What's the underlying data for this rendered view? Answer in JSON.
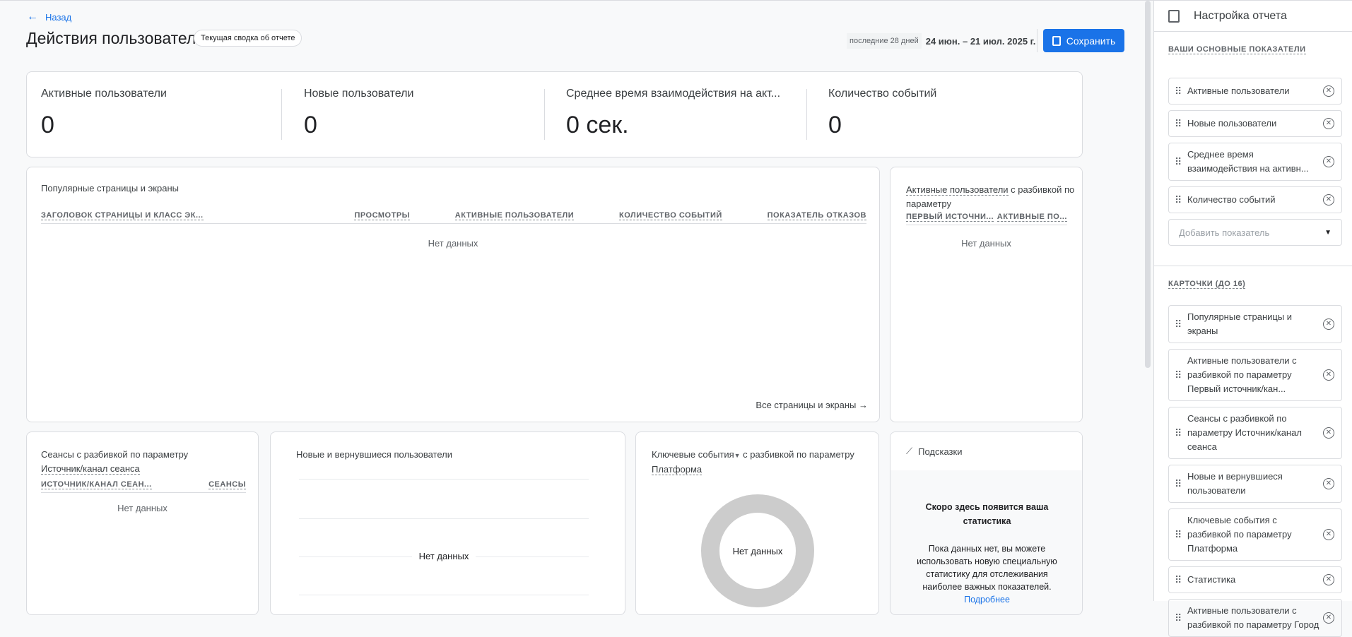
{
  "header": {
    "back": "Назад",
    "title": "Действия пользователей",
    "chip": "Текущая сводка об отчете",
    "date_preset": "последние 28 дней",
    "date_range": "24 июн. – 21 июл. 2025 г.",
    "save": "Сохранить"
  },
  "kpis": [
    {
      "label": "Активные пользователи",
      "value": "0"
    },
    {
      "label": "Новые пользователи",
      "value": "0"
    },
    {
      "label": "Среднее время взаимодействия на акт...",
      "value": "0 сек."
    },
    {
      "label": "Количество событий",
      "value": "0"
    }
  ],
  "pages_card": {
    "title": "Популярные страницы и экраны",
    "columns": [
      "ЗАГОЛОВОК СТРАНИЦЫ И КЛАСС ЭК...",
      "ПРОСМОТРЫ",
      "АКТИВНЫЕ ПОЛЬЗОВАТЕЛИ",
      "КОЛИЧЕСТВО СОБЫТИЙ",
      "ПОКАЗАТЕЛЬ ОТКАЗОВ"
    ],
    "empty": "Нет данных",
    "link": "Все страницы и экраны"
  },
  "first_source_card": {
    "title_metric": "Активные пользователи",
    "title_rest": " с разбивкой по параметру",
    "columns": [
      "ПЕРВЫЙ ИСТОЧНИ...",
      "АКТИВНЫЕ ПО..."
    ],
    "empty": "Нет данных"
  },
  "sessions_card": {
    "title": "Сеансы с разбивкой по параметру",
    "dimension": "Источник/канал сеанса",
    "columns": [
      "ИСТОЧНИК/КАНАЛ СЕАН...",
      "СЕАНСЫ"
    ],
    "empty": "Нет данных"
  },
  "new_returning_card": {
    "title": "Новые и вернувшиеся пользователи",
    "empty": "Нет данных"
  },
  "key_events_card": {
    "metric": "Ключевые события",
    "title_rest": " с разбивкой по параметру",
    "dimension": "Платформа",
    "empty": "Нет данных"
  },
  "insights_card": {
    "title": "Подсказки",
    "heading": "Скоро здесь появится ваша статистика",
    "body": "Пока данных нет, вы можете использовать новую специальную статистику для отслеживания наиболее важных показателей.",
    "link": "Подробнее"
  },
  "panel": {
    "title": "Настройка отчета",
    "metrics_label": "ВАШИ ОСНОВНЫЕ ПОКАЗАТЕЛИ",
    "metrics": [
      "Активные пользователи",
      "Новые пользователи",
      "Среднее время взаимодействия на активн...",
      "Количество событий"
    ],
    "add_metric": "Добавить показатель",
    "cards_label": "КАРТОЧКИ (ДО 16)",
    "cards": [
      "Популярные страницы и экраны",
      "Активные пользователи с разбивкой по параметру Первый источник/кан...",
      "Сеансы с разбивкой по параметру Источник/канал сеанса",
      "Новые и вернувшиеся пользователи",
      "Ключевые события с разбивкой по параметру Платформа",
      "Статистика",
      "Активные пользователи с разбивкой по параметру Город"
    ]
  },
  "colors": {
    "accent": "#1a73e8",
    "donut": "#cccccc"
  }
}
